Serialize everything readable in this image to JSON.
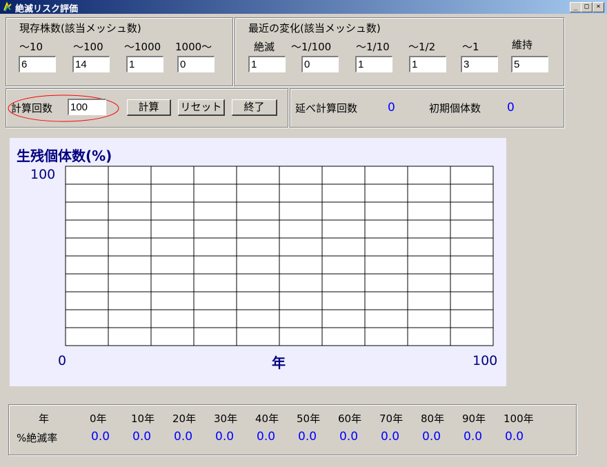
{
  "window": {
    "title": "絶滅リスク評価"
  },
  "current_stock": {
    "heading": "現存株数(該当メッシュ数)",
    "columns": [
      {
        "label": "〜10",
        "value": "6"
      },
      {
        "label": "〜100",
        "value": "14"
      },
      {
        "label": "〜1000",
        "value": "1"
      },
      {
        "label": "1000〜",
        "value": "0"
      }
    ]
  },
  "recent_change": {
    "heading": "最近の変化(該当メッシュ数)",
    "columns": [
      {
        "label": "絶滅",
        "value": "1"
      },
      {
        "label": "〜1/100",
        "value": "0"
      },
      {
        "label": "〜1/10",
        "value": "1"
      },
      {
        "label": "〜1/2",
        "value": "1"
      },
      {
        "label": "〜1",
        "value": "3"
      },
      {
        "label": "維持",
        "value": "5"
      }
    ]
  },
  "controls": {
    "calc_count_label": "計算回数",
    "calc_count_value": "100",
    "calc_button": "計算",
    "reset_button": "リセット",
    "exit_button": "終了"
  },
  "stats": {
    "total_calc_label": "延べ計算回数",
    "total_calc_value": "0",
    "initial_pop_label": "初期個体数",
    "initial_pop_value": "0"
  },
  "chart": {
    "ylabel": "生残個体数(%)",
    "ymax_label": "100",
    "xmin_label": "0",
    "xlabel": "年",
    "xmax_label": "100"
  },
  "chart_data": {
    "type": "line",
    "title": "",
    "ylabel": "生残個体数(%)",
    "xlabel": "年",
    "xlim": [
      0,
      100
    ],
    "ylim": [
      0,
      100
    ],
    "grid": true,
    "series": []
  },
  "rates": {
    "row_header": "年",
    "rate_label": "%絶滅率",
    "years": [
      "0年",
      "10年",
      "20年",
      "30年",
      "40年",
      "50年",
      "60年",
      "70年",
      "80年",
      "90年",
      "100年"
    ],
    "values": [
      "0.0",
      "0.0",
      "0.0",
      "0.0",
      "0.0",
      "0.0",
      "0.0",
      "0.0",
      "0.0",
      "0.0",
      "0.0"
    ]
  }
}
